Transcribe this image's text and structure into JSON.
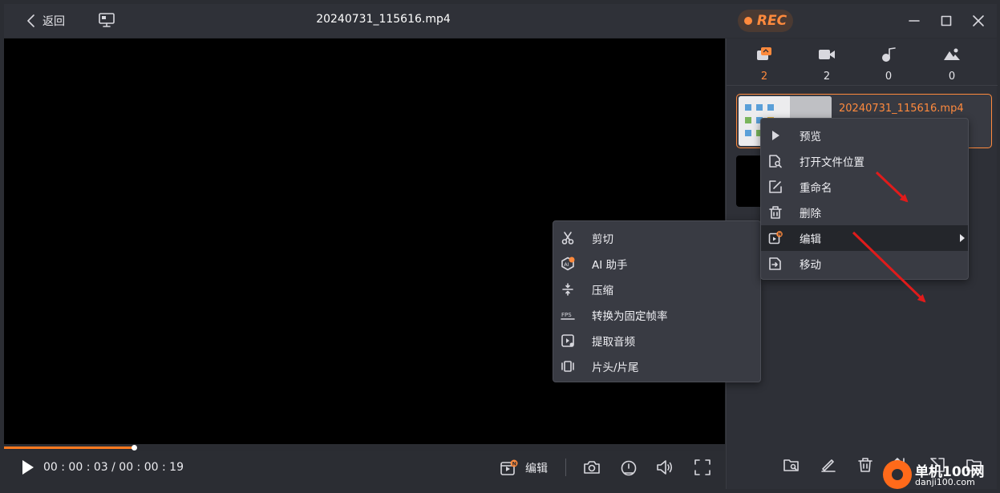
{
  "titlebar": {
    "back_label": "返回",
    "file_title": "20240731_115616.mp4",
    "rec_label": "REC"
  },
  "player": {
    "time_text": "00 : 00 : 03 / 00 : 00 : 19",
    "progress_fraction": 0.18,
    "edit_label": "编辑"
  },
  "panel": {
    "categories": [
      {
        "icon": "image-icon",
        "count": "2",
        "active": true
      },
      {
        "icon": "video-icon",
        "count": "2"
      },
      {
        "icon": "music-icon",
        "count": "0"
      },
      {
        "icon": "photo-icon",
        "count": "0"
      }
    ],
    "files": [
      {
        "name": "20240731_115616.mp4",
        "selected": true
      }
    ]
  },
  "context_menu": {
    "items": [
      {
        "icon": "play-icon",
        "label": "预览"
      },
      {
        "icon": "folder-search-icon",
        "label": "打开文件位置"
      },
      {
        "icon": "rename-icon",
        "label": "重命名"
      },
      {
        "icon": "trash-icon",
        "label": "删除"
      },
      {
        "icon": "edit-ai-icon",
        "label": "编辑",
        "highlighted": true,
        "has_submenu": true
      },
      {
        "icon": "move-icon",
        "label": "移动"
      }
    ]
  },
  "edit_submenu": {
    "items": [
      {
        "icon": "scissors-icon",
        "label": "剪切"
      },
      {
        "icon": "ai-assistant-icon",
        "label": "AI 助手"
      },
      {
        "icon": "compress-icon",
        "label": "压缩"
      },
      {
        "icon": "fps-icon",
        "label": "转换为固定帧率"
      },
      {
        "icon": "extract-audio-icon",
        "label": "提取音频"
      },
      {
        "icon": "intro-outro-icon",
        "label": "片头/片尾"
      }
    ]
  },
  "watermark": {
    "text": "单机100网",
    "sub": "danji100.com"
  },
  "colors": {
    "accent": "#ff8a3d",
    "background": "#2b2d33",
    "menu_bg": "#393b43",
    "highlight_row": "#24262b",
    "arrow_red": "#e01b1b"
  }
}
